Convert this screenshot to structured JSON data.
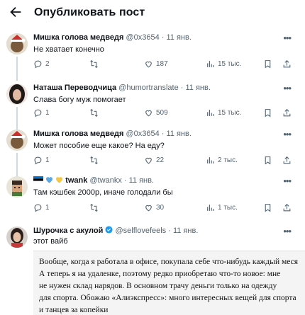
{
  "header": {
    "title": "Опубликовать пост"
  },
  "posts": [
    {
      "name": "Мишка голова медведя",
      "handle": "@0x3654",
      "time": "· 11 янв.",
      "text": "Не хватает конечно",
      "replies": "2",
      "reposts": "",
      "likes": "187",
      "views": "15 тыс."
    },
    {
      "name": "Наташа Переводчица",
      "handle": "@humortranslate",
      "time": "· 11 янв.",
      "text": "Слава богу муж помогает",
      "replies": "1",
      "reposts": "",
      "likes": "509",
      "views": "15 тыс."
    },
    {
      "name": "Мишка голова медведя",
      "handle": "@0x3654",
      "time": "· 11 янв.",
      "text": "Может пособие еще какое? На еду?",
      "replies": "1",
      "reposts": "",
      "likes": "22",
      "views": "2 тыс."
    },
    {
      "name": "twank",
      "handle": "@twankx",
      "time": "· 11 янв.",
      "text": "Там кэшбек 2000р, иначе голодали бы",
      "replies": "1",
      "reposts": "",
      "likes": "30",
      "views": "1 тыс."
    },
    {
      "name": "Шурочка с акулой",
      "handle": "@selflovefeels",
      "time": "· 11 янв.",
      "text": "этот вайб"
    }
  ],
  "quote": {
    "text": "Вообще, когда я работала в офисе, покупала себе что-нибудь каждый меся\nА теперь я на удаленке, поэтому редко приобретаю что-то новое: мне\nне нужен склад нарядов. В основном трачу деньги только на одежду\nдля спорта. Обожаю «Алиэкспресс»: много интересных вещей для спорта\nи танцев за копейки"
  },
  "colors": {
    "text": "#0f1419",
    "secondary": "#536471",
    "verified": "#1d9bf0",
    "thread": "#cfd9de"
  },
  "icons": [
    "back-arrow-icon",
    "reply-icon",
    "repost-icon",
    "like-icon",
    "views-icon",
    "bookmark-icon",
    "share-icon",
    "more-icon",
    "verified-icon"
  ]
}
